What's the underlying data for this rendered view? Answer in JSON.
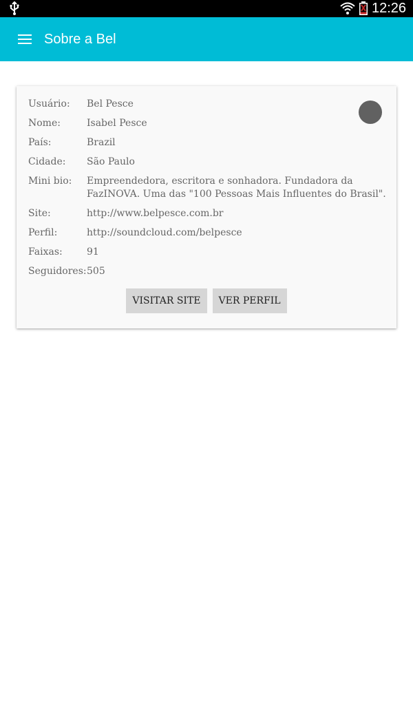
{
  "status_bar": {
    "time": "12:26",
    "icons": [
      "usb-icon",
      "wifi-icon",
      "battery-icon"
    ]
  },
  "toolbar": {
    "title": "Sobre a Bel",
    "menu_icon": "hamburger-menu-icon",
    "background_color": "#00bcd6"
  },
  "profile": {
    "rows": [
      {
        "label": "Usuário:",
        "value": "Bel Pesce"
      },
      {
        "label": "Nome:",
        "value": "Isabel Pesce"
      },
      {
        "label": "País:",
        "value": "Brazil"
      },
      {
        "label": "Cidade:",
        "value": "São Paulo"
      },
      {
        "label": "Mini bio:",
        "value": "Empreendedora, escritora e sonhadora. Fundadora da FazINOVA. Uma das \"100 Pessoas Mais Influentes do Brasil\"."
      },
      {
        "label": "Site:",
        "value": "http://www.belpesce.com.br"
      },
      {
        "label": "Perfil:",
        "value": "http://soundcloud.com/belpesce"
      },
      {
        "label": "Faixas:",
        "value": "91"
      },
      {
        "label": "Seguidores:",
        "value": "505"
      }
    ],
    "buttons": {
      "visit_site": "VISITAR SITE",
      "view_profile": "VER PERFIL"
    }
  }
}
